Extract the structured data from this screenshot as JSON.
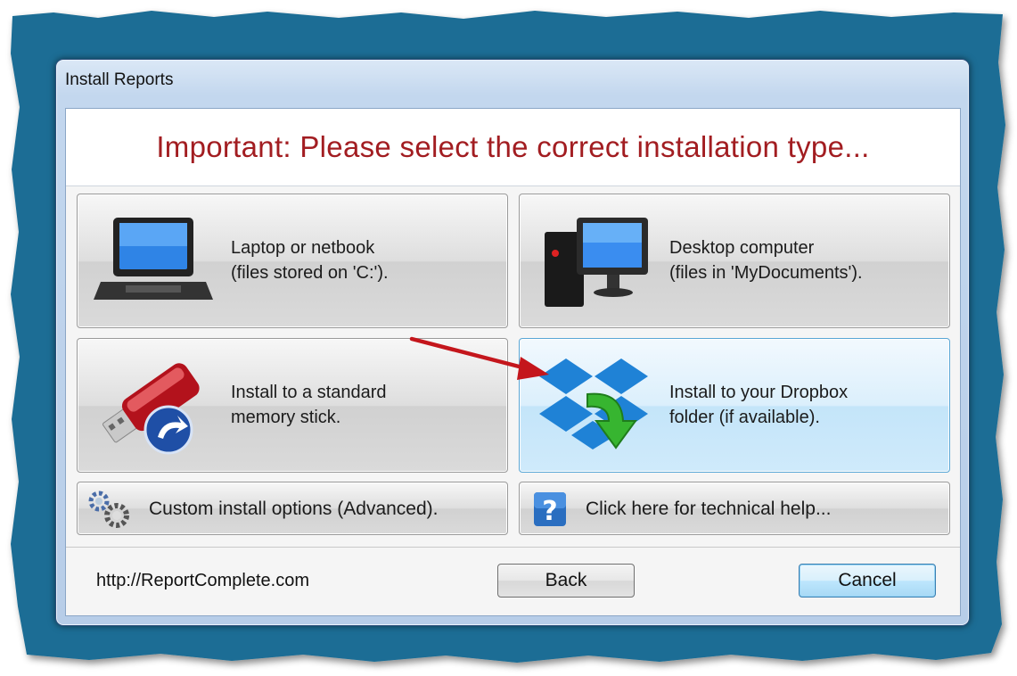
{
  "window": {
    "title": "Install Reports"
  },
  "banner": {
    "text": "Important: Please select the correct installation type..."
  },
  "options": {
    "laptop": {
      "label": "Laptop or netbook\n(files stored on 'C:')."
    },
    "desktop": {
      "label": "Desktop computer\n(files in 'MyDocuments')."
    },
    "memory_stick": {
      "label": "Install to a standard\nmemory stick."
    },
    "dropbox": {
      "label": "Install to your Dropbox\nfolder (if available)."
    },
    "custom": {
      "label": "Custom install options (Advanced)."
    },
    "help": {
      "label": "Click here for technical help..."
    }
  },
  "footer": {
    "link": "http://ReportComplete.com",
    "back_label": "Back",
    "cancel_label": "Cancel"
  },
  "colors": {
    "frame": "#1a6d95",
    "banner_text": "#a21d21",
    "annotation_arrow": "#c4161c",
    "hover_tile": "#cfeafb"
  },
  "icons": [
    "laptop-icon",
    "desktop-computer-icon",
    "usb-stick-icon",
    "dropbox-icon",
    "gears-icon",
    "help-icon"
  ]
}
